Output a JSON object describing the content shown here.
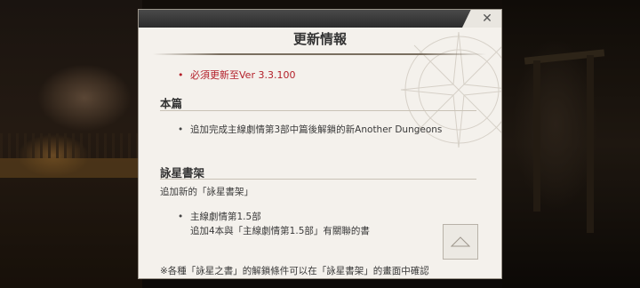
{
  "modal": {
    "close_label": "✕",
    "title": "更新情報",
    "required_update": "必須更新至Ver 3.3.100",
    "sections": [
      {
        "heading": "本篇",
        "bullets": [
          "追加完成主線劇情第3部中篇後解鎖的新Another Dungeons"
        ]
      },
      {
        "heading": "詠星書架",
        "intro": "追加新的「詠星書架」",
        "bullet_line1": "主線劇情第1.5部",
        "bullet_line2": "追加4本與「主線劇情第1.5部」有關聯的書",
        "note": "※各種「詠星之書」的解鎖條件可以在「詠星書架」的畫面中確認"
      }
    ],
    "bullet_glyph": "•"
  },
  "colors": {
    "required_update": "#b3202a",
    "panel_background": "#f4f1ec"
  }
}
